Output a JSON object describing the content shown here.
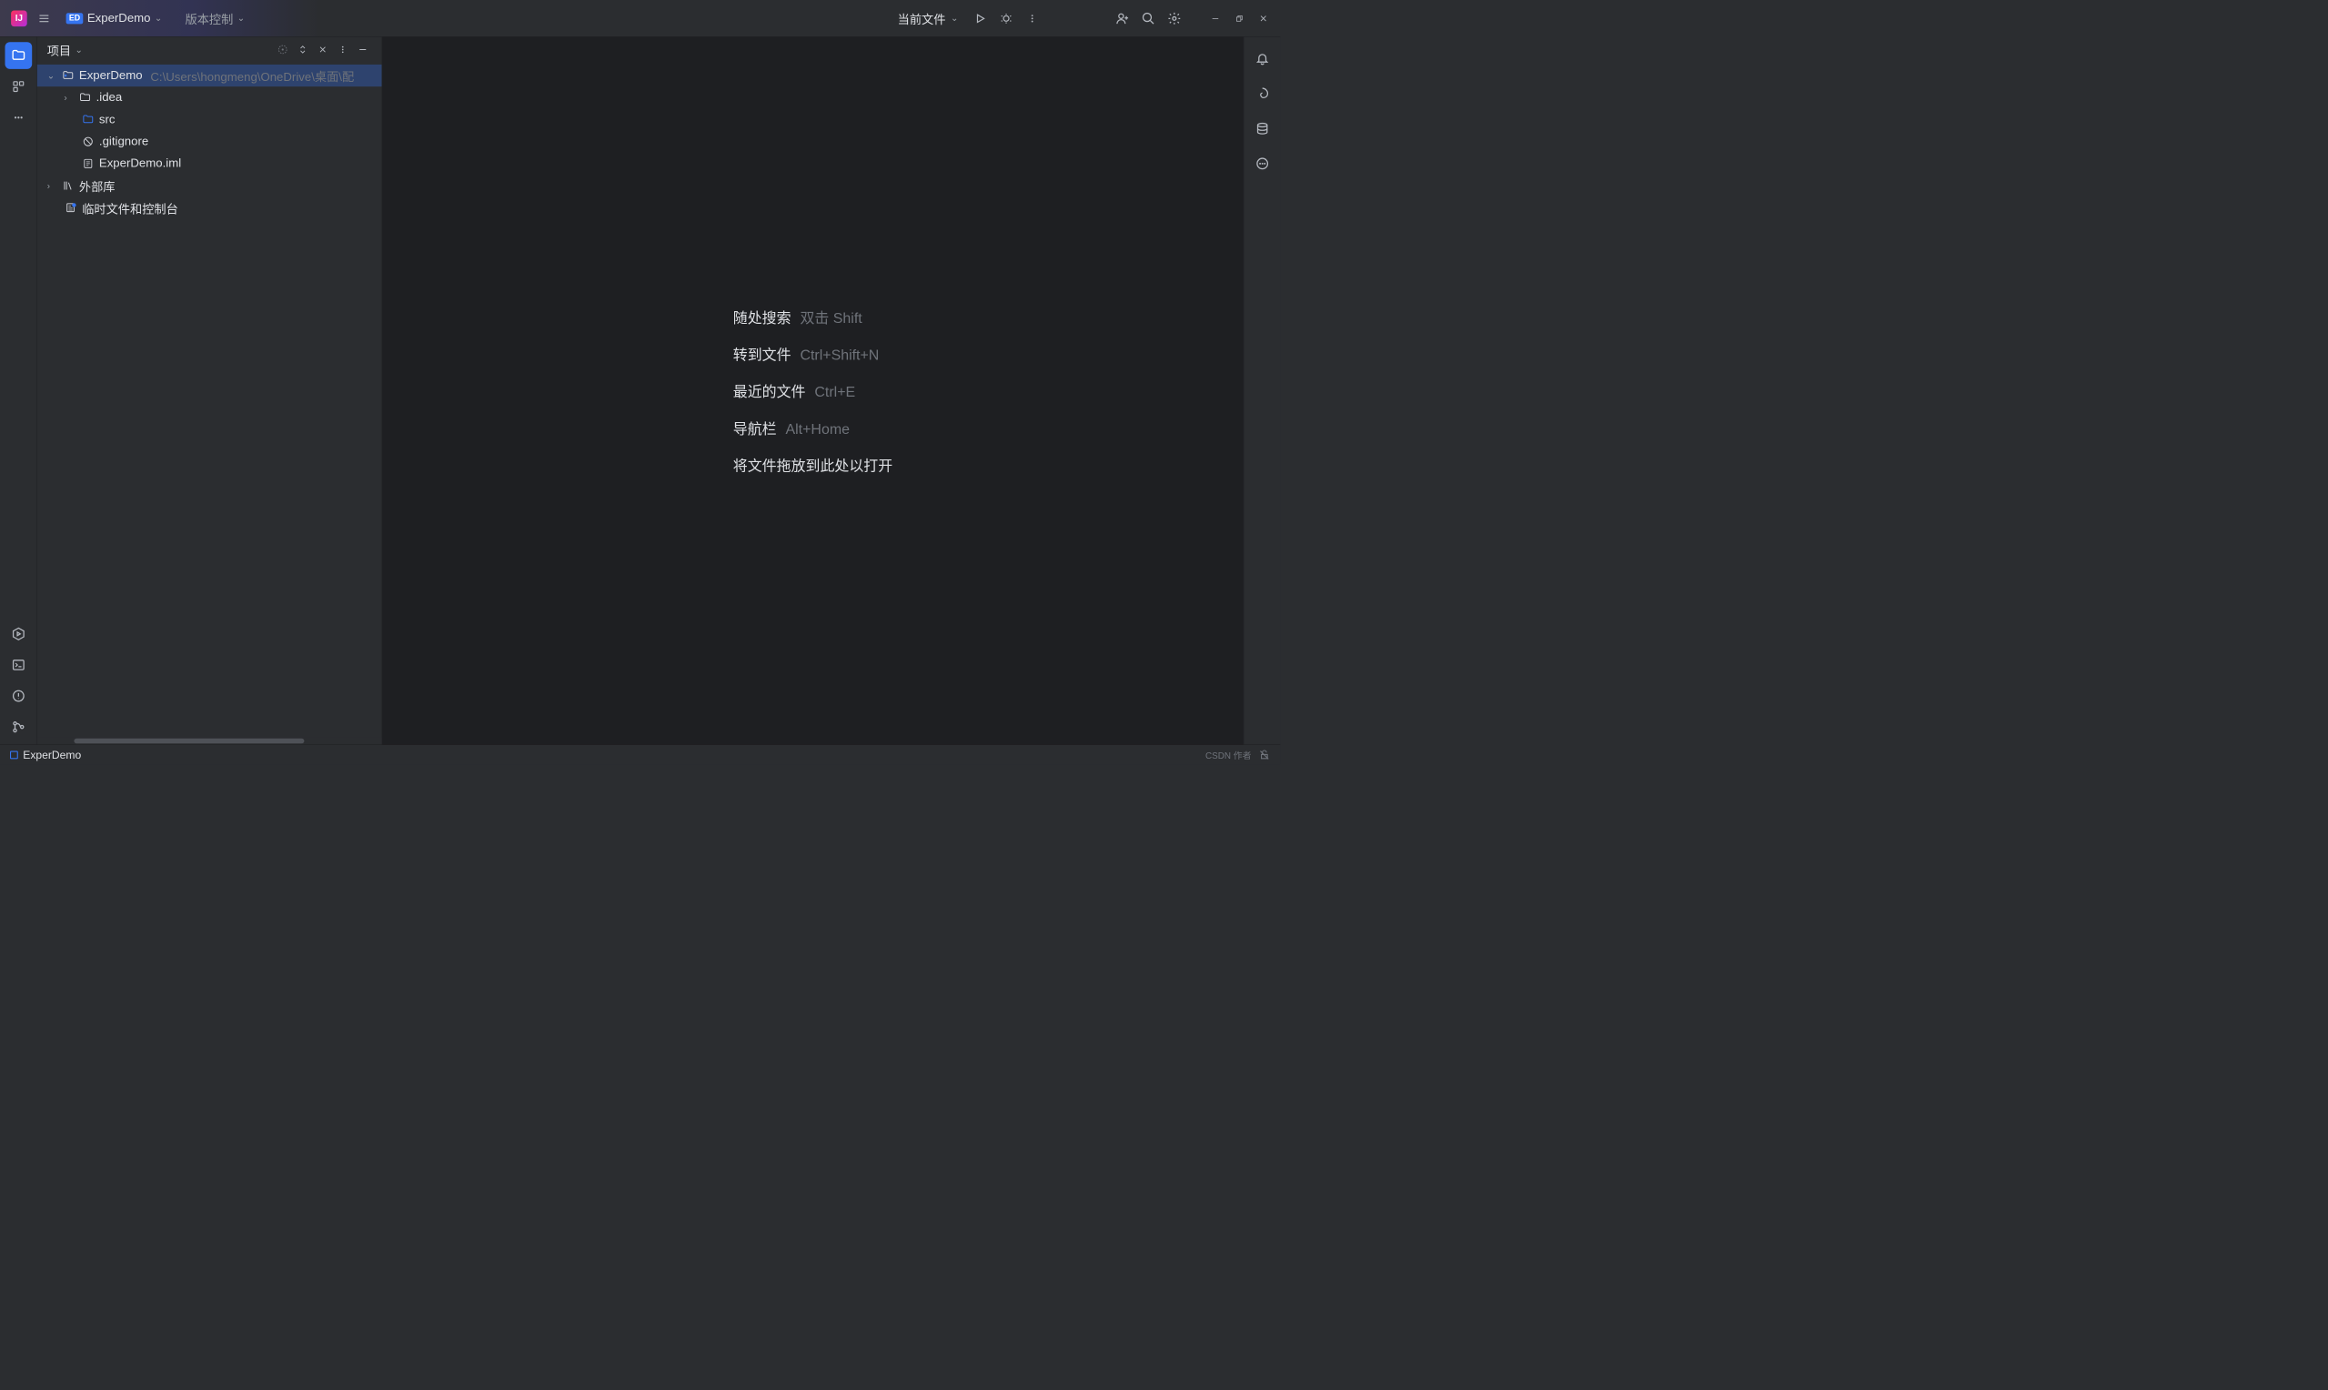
{
  "titleBar": {
    "projectBadge": "ED",
    "projectName": "ExperDemo",
    "vcsLabel": "版本控制",
    "runConfig": "当前文件"
  },
  "projectPanel": {
    "title": "项目",
    "tree": {
      "root": {
        "name": "ExperDemo",
        "path": "C:\\Users\\hongmeng\\OneDrive\\桌面\\配"
      },
      "children": {
        "idea": ".idea",
        "src": "src",
        "gitignore": ".gitignore",
        "iml": "ExperDemo.iml"
      },
      "external": "外部库",
      "scratch": "临时文件和控制台"
    }
  },
  "editor": {
    "hints": {
      "search": {
        "label": "随处搜索",
        "key": "双击 Shift"
      },
      "gotoFile": {
        "label": "转到文件",
        "key": "Ctrl+Shift+N"
      },
      "recent": {
        "label": "最近的文件",
        "key": "Ctrl+E"
      },
      "navbar": {
        "label": "导航栏",
        "key": "Alt+Home"
      },
      "drop": {
        "label": "将文件拖放到此处以打开"
      }
    }
  },
  "statusBar": {
    "project": "ExperDemo",
    "watermark": "CSDN 作者"
  }
}
